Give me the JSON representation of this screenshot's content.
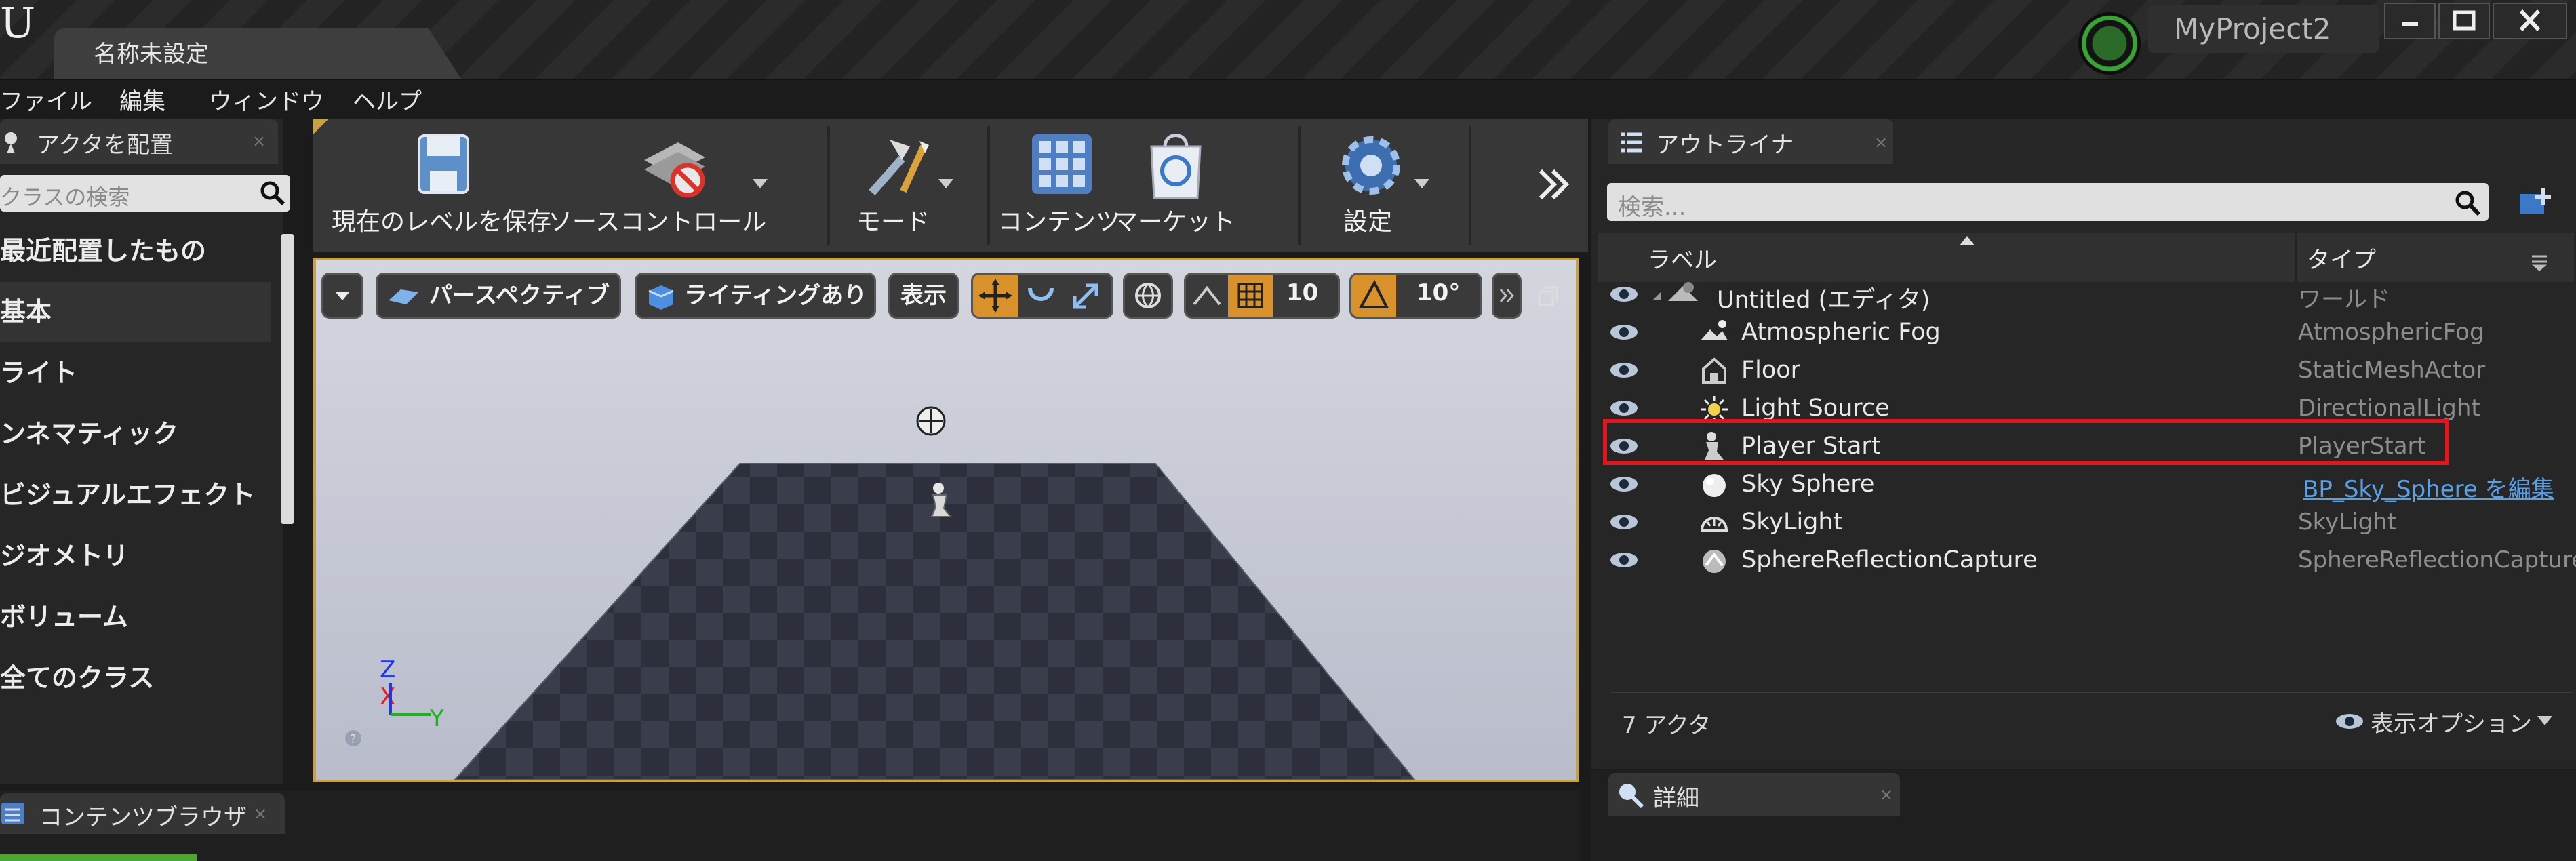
{
  "window": {
    "logo": "U",
    "doc_tab": "名称未設定",
    "project_name": "MyProject2"
  },
  "menu": [
    "ファイル",
    "編集",
    "ウィンドウ",
    "ヘルプ"
  ],
  "place_actors": {
    "tab": "アクタを配置",
    "search_placeholder": "クラスの検索",
    "categories": [
      "最近配置したもの",
      "基本",
      "ライト",
      "ンネマティック",
      "ビジュアルエフェクト",
      "ジオメトリ",
      "ボリューム",
      "全てのクラス"
    ]
  },
  "toolbar": {
    "save": "現在のレベルを保存",
    "source_control": "ソースコントロール",
    "modes": "モード",
    "content": "コンテンツ",
    "marketplace": "マーケット",
    "settings": "設定"
  },
  "viewport": {
    "perspective": "パースペクティブ",
    "lighting": "ライティングあり",
    "show": "表示",
    "grid_snap": "10",
    "rotation_snap": "10°",
    "axis_z": "Z",
    "axis_x": "X",
    "axis_y": "Y"
  },
  "outliner": {
    "tab": "アウトライナ",
    "search_placeholder": "検索...",
    "col_label": "ラベル",
    "col_type": "タイプ",
    "rows": [
      {
        "label": "Untitled (エディタ)",
        "type": "ワールド",
        "icon": "world-icon",
        "highlighted": false
      },
      {
        "label": "Atmospheric Fog",
        "type": "AtmosphericFog",
        "icon": "fog-icon",
        "highlighted": false
      },
      {
        "label": "Floor",
        "type": "StaticMeshActor",
        "icon": "mesh-icon",
        "highlighted": false
      },
      {
        "label": "Light Source",
        "type": "DirectionalLight",
        "icon": "sun-icon",
        "highlighted": false
      },
      {
        "label": "Player Start",
        "type": "PlayerStart",
        "icon": "player-start-icon",
        "highlighted": true
      },
      {
        "label": "Sky Sphere",
        "type": "BP_Sky_Sphere を編集",
        "icon": "sphere-icon",
        "highlighted": false
      },
      {
        "label": "SkyLight",
        "type": "SkyLight",
        "icon": "skylight-icon",
        "highlighted": false
      },
      {
        "label": "SphereReflectionCapture",
        "type": "SphereReflectionCapture",
        "icon": "reflection-icon",
        "highlighted": false
      }
    ],
    "actor_count": "7 アクタ",
    "view_options": "表示オプション"
  },
  "details": {
    "tab": "詳細"
  },
  "content_browser": {
    "tab": "コンテンツブラウザ"
  },
  "colors": {
    "highlight": "#e0161e",
    "accent": "#c8a046",
    "link": "#5aa0e6"
  }
}
